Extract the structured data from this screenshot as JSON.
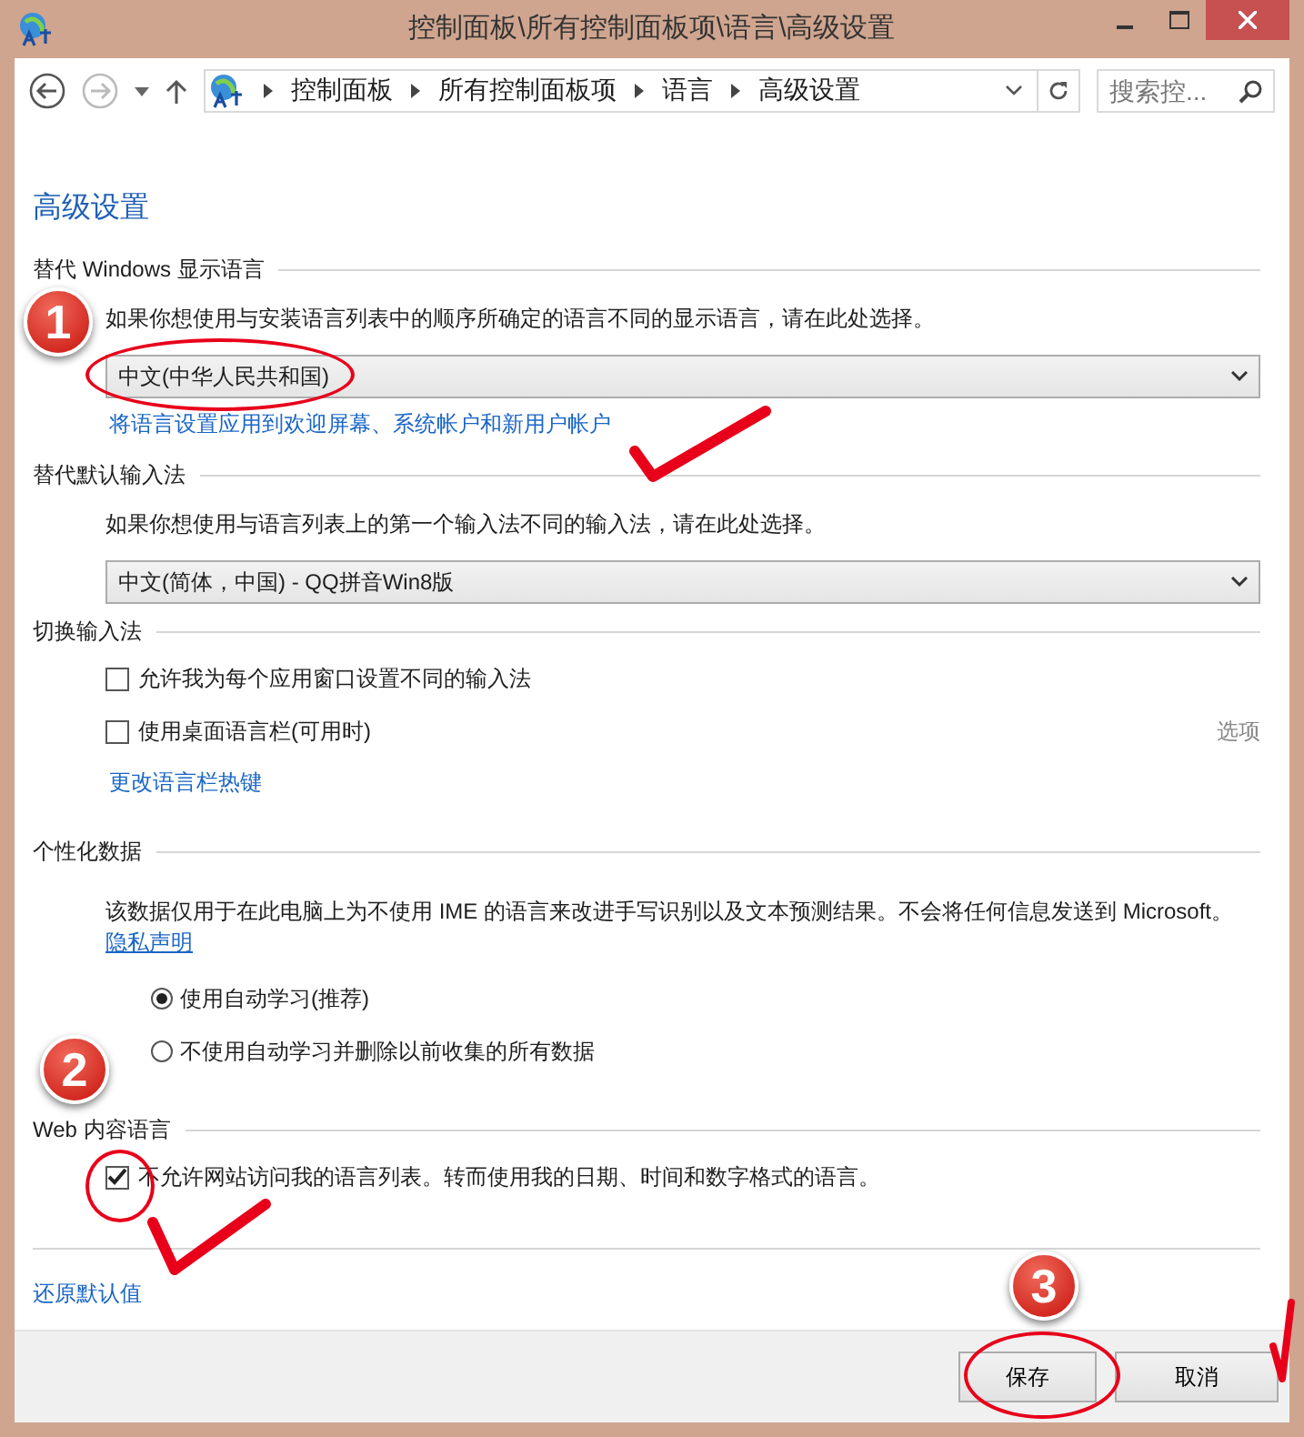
{
  "window": {
    "title": "控制面板\\所有控制面板项\\语言\\高级设置"
  },
  "address_bar": {
    "breadcrumbs": [
      "控制面板",
      "所有控制面板项",
      "语言",
      "高级设置"
    ],
    "search_placeholder": "搜索控..."
  },
  "page_title": "高级设置",
  "sections": [
    {
      "kind": "dropdown",
      "heading": "替代 Windows 显示语言",
      "description": "如果你想使用与安装语言列表中的顺序所确定的语言不同的显示语言，请在此处选择。",
      "value": "中文(中华人民共和国)",
      "link": "将语言设置应用到欢迎屏幕、系统帐户和新用户帐户"
    },
    {
      "kind": "dropdown",
      "heading": "替代默认输入法",
      "description": "如果你想使用与语言列表上的第一个输入法不同的输入法，请在此处选择。",
      "value": "中文(简体，中国) - QQ拼音Win8版"
    },
    {
      "kind": "checkboxes",
      "heading": "切换输入法",
      "options": [
        {
          "label": "允许我为每个应用窗口设置不同的输入法",
          "checked": false
        },
        {
          "label": "使用桌面语言栏(可用时)",
          "checked": false,
          "side_link": "选项"
        }
      ],
      "link": "更改语言栏热键"
    },
    {
      "kind": "radios",
      "heading": "个性化数据",
      "description": "该数据仅用于在此电脑上为不使用 IME 的语言来改进手写识别以及文本预测结果。不会将任何信息发送到 Microsoft。",
      "privacy_link": "隐私声明",
      "options": [
        {
          "label": "使用自动学习(推荐)",
          "selected": true
        },
        {
          "label": "不使用自动学习并删除以前收集的所有数据",
          "selected": false
        }
      ]
    },
    {
      "kind": "checkboxes",
      "heading": "Web 内容语言",
      "options": [
        {
          "label": "不允许网站访问我的语言列表。转而使用我的日期、时间和数字格式的语言。",
          "checked": true
        }
      ]
    }
  ],
  "restore_link": "还原默认值",
  "buttons": [
    "保存",
    "取消"
  ],
  "annotations": [
    "1",
    "2",
    "3"
  ]
}
